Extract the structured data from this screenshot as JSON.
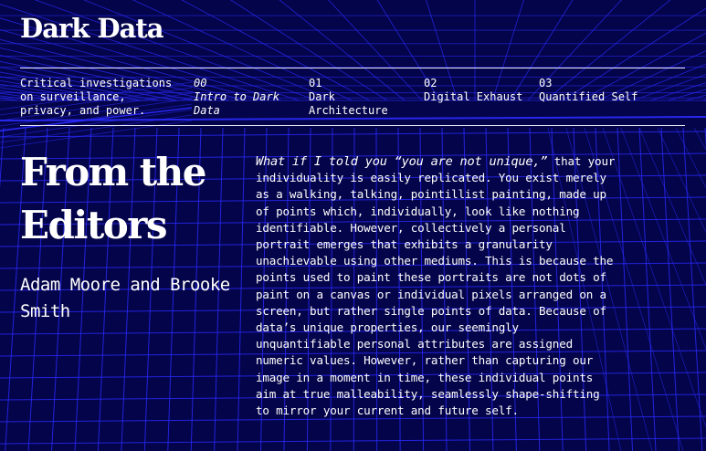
{
  "site": {
    "title": "Dark Data"
  },
  "header": {
    "tagline": "Critical investigations on surveillance, privacy, and power.",
    "nav": [
      {
        "num": "00",
        "label": "Intro to Dark Data",
        "italic": true
      },
      {
        "num": "01",
        "label": "Dark Architecture",
        "italic": false
      },
      {
        "num": "02",
        "label": "Digital Exhaust",
        "italic": false
      },
      {
        "num": "03",
        "label": "Quantified Self",
        "italic": false
      }
    ]
  },
  "article": {
    "heading": "From the Editors",
    "authors": "Adam Moore and Brooke Smith",
    "lede": "What if I told you “you are not unique,”",
    "body": "that your individuality is easily replicated. You exist merely as a walking, talking, pointillist painting, made up of points which, individually, look like nothing identifiable. However, collectively a personal portrait emerges that exhibits a granularity unachievable using other mediums. This is because the points used to paint these portraits are not dots of paint on a canvas or individual pixels arranged on a screen, but rather single points of data. Because of data’s unique properties, our seemingly unquantifiable personal attributes are assigned numeric values. However, rather than capturing our image in a moment in time, these individual points aim at true malleability, seamlessly shape-shifting to mirror your current and future self."
  },
  "colors": {
    "background": "#04044a",
    "grid": "#2b2bff",
    "text": "#ffffff"
  }
}
